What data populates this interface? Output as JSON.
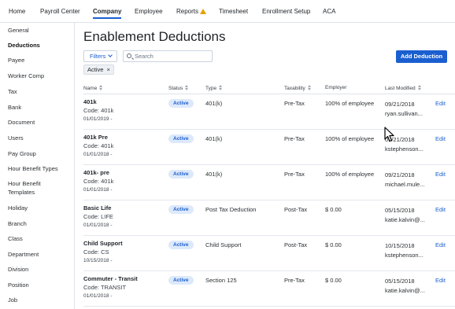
{
  "nav": {
    "items": [
      {
        "label": "Home"
      },
      {
        "label": "Payroll Center"
      },
      {
        "label": "Company"
      },
      {
        "label": "Employee"
      },
      {
        "label": "Reports"
      },
      {
        "label": "Timesheet"
      },
      {
        "label": "Enrollment Setup"
      },
      {
        "label": "ACA"
      }
    ],
    "active_index": 2,
    "reports_icon": "warning-icon"
  },
  "sidebar": {
    "items": [
      {
        "label": "General"
      },
      {
        "label": "Deductions"
      },
      {
        "label": "Payee"
      },
      {
        "label": "Worker Comp"
      },
      {
        "label": "Tax"
      },
      {
        "label": "Bank"
      },
      {
        "label": "Document"
      },
      {
        "label": "Users"
      },
      {
        "label": "Pay Group"
      },
      {
        "label": "Hour Benefit Types"
      },
      {
        "label": "Hour Benefit Templates"
      },
      {
        "label": "Holiday"
      },
      {
        "label": "Branch"
      },
      {
        "label": "Class"
      },
      {
        "label": "Department"
      },
      {
        "label": "Division"
      },
      {
        "label": "Position"
      },
      {
        "label": "Job"
      }
    ],
    "active_index": 1
  },
  "main": {
    "title": "Enablement Deductions",
    "filters_label": "Filters",
    "search_placeholder": "Search",
    "add_label": "Add Deduction",
    "chip_label": "Active",
    "chip_close": "×"
  },
  "table": {
    "headers": [
      "Name",
      "Status",
      "Type",
      "Taxability",
      "Employer",
      "Last Modified"
    ],
    "rows": [
      {
        "name": "401k",
        "code": "Code: 401k",
        "date": "01/01/2019 -",
        "status": "Active",
        "type": "401(k)",
        "taxability": "Pre-Tax",
        "employer": "100% of employee",
        "modified_date": "09/21/2018",
        "modified_by": "ryan.sullivan...",
        "edit": "Edit"
      },
      {
        "name": "401k Pre",
        "code": "Code: 401k",
        "date": "01/01/2018 -",
        "status": "Active",
        "type": "401(k)",
        "taxability": "Pre-Tax",
        "employer": "100% of employee",
        "modified_date": "09/21/2018",
        "modified_by": "kstephenson...",
        "edit": "Edit"
      },
      {
        "name": "401k- pre",
        "code": "Code: 401k",
        "date": "01/01/2018 -",
        "status": "Active",
        "type": "401(k)",
        "taxability": "Pre-Tax",
        "employer": "100% of employee",
        "modified_date": "09/21/2018",
        "modified_by": "michael.mule...",
        "edit": "Edit"
      },
      {
        "name": "Basic Life",
        "code": "Code: LIFE",
        "date": "01/01/2018 -",
        "status": "Active",
        "type": "Post Tax Deduction",
        "taxability": "Post-Tax",
        "employer": "$ 0.00",
        "modified_date": "05/15/2018",
        "modified_by": "katie.kalvin@...",
        "edit": "Edit"
      },
      {
        "name": "Child Support",
        "code": "Code: CS",
        "date": "10/15/2018 -",
        "status": "Active",
        "type": "Child Support",
        "taxability": "Post-Tax",
        "employer": "$ 0.00",
        "modified_date": "10/15/2018",
        "modified_by": "kstephenson...",
        "edit": "Edit"
      },
      {
        "name": "Commuter - Transit",
        "code": "Code: TRANSIT",
        "date": "01/01/2018 -",
        "status": "Active",
        "type": "Section 125",
        "taxability": "Pre-Tax",
        "employer": "$ 0.00",
        "modified_date": "05/15/2018",
        "modified_by": "katie.kalvin@...",
        "edit": "Edit"
      }
    ]
  },
  "colors": {
    "accent": "#1a5fd0",
    "badge_bg": "#dde9fb",
    "warning": "#e6a100"
  }
}
